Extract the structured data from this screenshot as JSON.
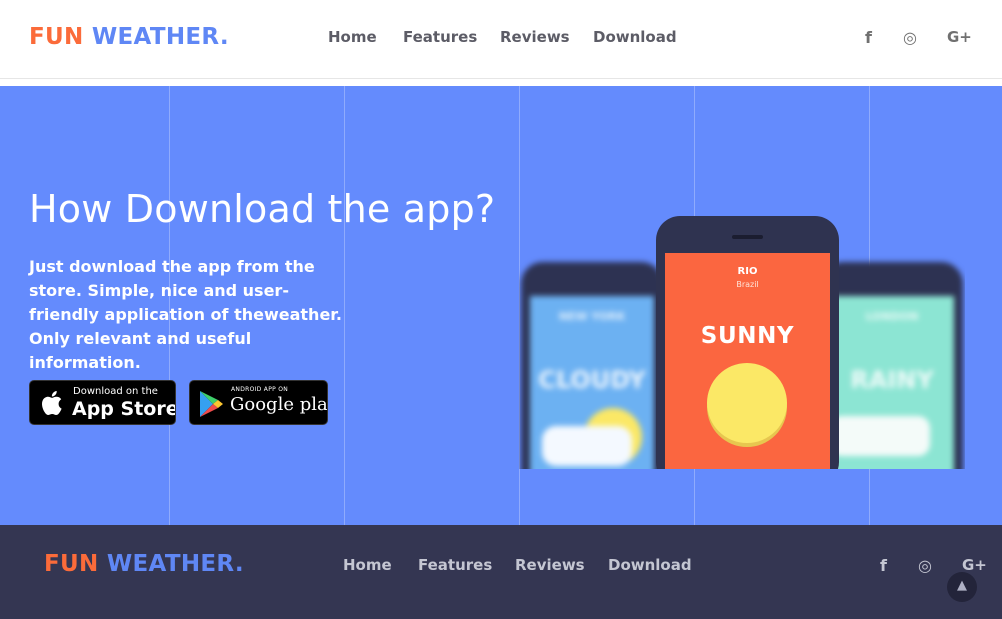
{
  "header": {
    "logo": {
      "part1": "FUN",
      "part2": "WEATHER."
    },
    "nav": [
      "Home",
      "Features",
      "Reviews",
      "Download"
    ],
    "social": [
      {
        "icon": "facebook-icon",
        "glyph": "f"
      },
      {
        "icon": "instagram-icon",
        "glyph": "◎"
      },
      {
        "icon": "google-plus-icon",
        "glyph": "G+"
      }
    ]
  },
  "hero": {
    "title": "How Download the app?",
    "text": "Just download the app from the store. Simple, nice and user-friendly application of theweather. Only relevant and useful information.",
    "app_store": {
      "small": "Download on the",
      "big": "App Store"
    },
    "google_play": {
      "small": "ANDROID APP ON",
      "big": "Google play"
    },
    "phones": {
      "left": {
        "city": "NEW YORK",
        "condition": "CLOUDY"
      },
      "center": {
        "city": "RIO",
        "country": "Brazil",
        "condition": "SUNNY"
      },
      "right": {
        "city": "LONDON",
        "condition": "RAINY"
      }
    }
  },
  "footer": {
    "logo": {
      "part1": "FUN",
      "part2": "WEATHER."
    },
    "nav": [
      "Home",
      "Features",
      "Reviews",
      "Download"
    ],
    "social": [
      {
        "icon": "facebook-icon",
        "glyph": "f"
      },
      {
        "icon": "instagram-icon",
        "glyph": "◎"
      },
      {
        "icon": "google-plus-icon",
        "glyph": "G+"
      }
    ],
    "back_to_top": {
      "icon": "chevron-up-icon",
      "glyph": "▲"
    }
  },
  "colors": {
    "accent_orange": "#fb6b3a",
    "accent_blue": "#5f87f5",
    "hero_bg": "#648bfd",
    "footer_bg": "#343652"
  }
}
